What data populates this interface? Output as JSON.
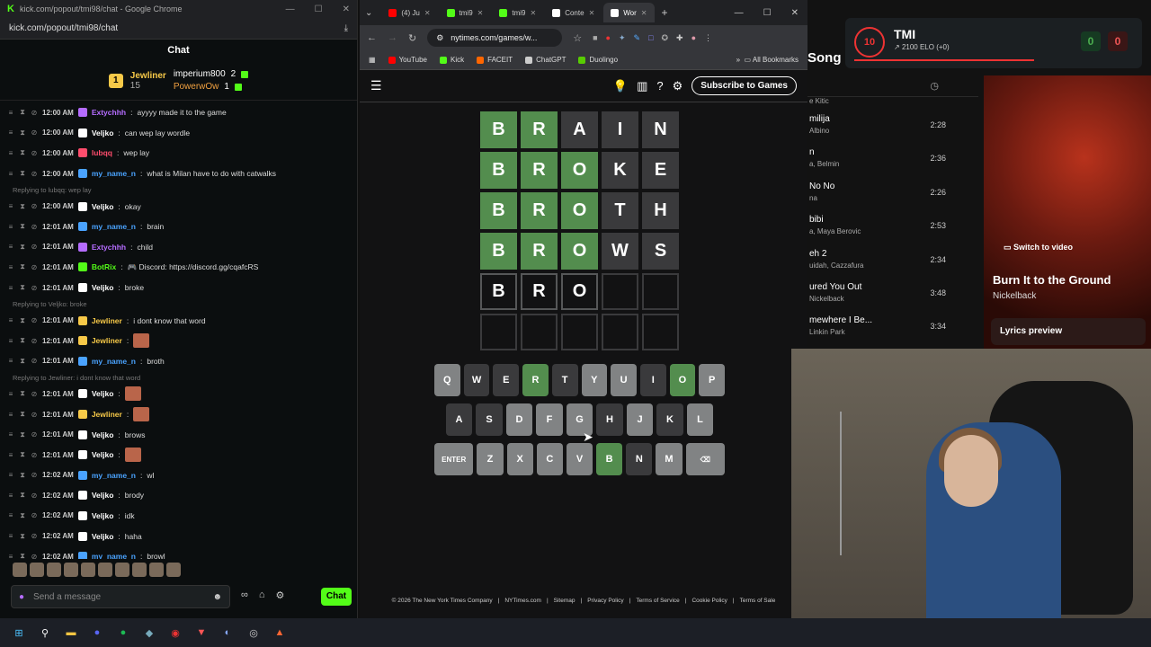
{
  "chat_window": {
    "title": "kick.com/popout/tmi98/chat - Google Chrome",
    "url": "kick.com/popout/tmi98/chat",
    "header": "Chat",
    "leaderboard": {
      "top_name": "Jewliner",
      "top_value": "15",
      "others": [
        {
          "name": "imperium800",
          "value": "2"
        },
        {
          "name": "PowerwOw",
          "value": "1"
        }
      ]
    },
    "messages": [
      {
        "type": "msg",
        "time": "12:00 AM",
        "user": "Extychhh",
        "color": "#b56cff",
        "text": "ayyyy made it to the game"
      },
      {
        "type": "msg",
        "time": "12:00 AM",
        "user": "Veljko",
        "color": "#ffffff",
        "text": "can wep lay wordle"
      },
      {
        "type": "msg",
        "time": "12:00 AM",
        "user": "lubqq",
        "color": "#ff4d6d",
        "text": "wep lay"
      },
      {
        "type": "msg",
        "time": "12:00 AM",
        "user": "my_name_n",
        "color": "#4aa3ff",
        "text": "what is Milan have to do with catwalks"
      },
      {
        "type": "reply",
        "text": "Replying to lubqq: wep lay"
      },
      {
        "type": "msg",
        "time": "12:00 AM",
        "user": "Veljko",
        "color": "#ffffff",
        "text": "okay"
      },
      {
        "type": "msg",
        "time": "12:01 AM",
        "user": "my_name_n",
        "color": "#4aa3ff",
        "text": "brain"
      },
      {
        "type": "msg",
        "time": "12:01 AM",
        "user": "Extychhh",
        "color": "#b56cff",
        "text": "child"
      },
      {
        "type": "msg",
        "time": "12:01 AM",
        "user": "BotRix",
        "color": "#53fc18",
        "text": "🎮 Discord: https://discord.gg/cqafcRS"
      },
      {
        "type": "msg",
        "time": "12:01 AM",
        "user": "Veljko",
        "color": "#ffffff",
        "text": "broke"
      },
      {
        "type": "reply",
        "text": "Replying to Veljko: broke"
      },
      {
        "type": "msg",
        "time": "12:01 AM",
        "user": "Jewliner",
        "color": "#f7c948",
        "text": "i dont know that word"
      },
      {
        "type": "msg",
        "time": "12:01 AM",
        "user": "Jewliner",
        "color": "#f7c948",
        "text": "",
        "emote": true
      },
      {
        "type": "msg",
        "time": "12:01 AM",
        "user": "my_name_n",
        "color": "#4aa3ff",
        "text": "broth"
      },
      {
        "type": "reply",
        "text": "Replying to Jewliner: i dont know that word"
      },
      {
        "type": "msg",
        "time": "12:01 AM",
        "user": "Veljko",
        "color": "#ffffff",
        "text": "",
        "emote": true
      },
      {
        "type": "msg",
        "time": "12:01 AM",
        "user": "Jewliner",
        "color": "#f7c948",
        "text": "",
        "emote": true
      },
      {
        "type": "msg",
        "time": "12:01 AM",
        "user": "Veljko",
        "color": "#ffffff",
        "text": "brows"
      },
      {
        "type": "msg",
        "time": "12:01 AM",
        "user": "Veljko",
        "color": "#ffffff",
        "text": "",
        "emote": true
      },
      {
        "type": "msg",
        "time": "12:02 AM",
        "user": "my_name_n",
        "color": "#4aa3ff",
        "text": "wl"
      },
      {
        "type": "msg",
        "time": "12:02 AM",
        "user": "Veljko",
        "color": "#ffffff",
        "text": "brody"
      },
      {
        "type": "msg",
        "time": "12:02 AM",
        "user": "Veljko",
        "color": "#ffffff",
        "text": "idk"
      },
      {
        "type": "msg",
        "time": "12:02 AM",
        "user": "Veljko",
        "color": "#ffffff",
        "text": "haha"
      },
      {
        "type": "msg",
        "time": "12:02 AM",
        "user": "my_name_n",
        "color": "#4aa3ff",
        "text": "browl"
      }
    ],
    "send_placeholder": "Send a message",
    "chat_button": "Chat"
  },
  "browser": {
    "tabs": [
      {
        "label": "(4) Ju",
        "color": "#ff0000"
      },
      {
        "label": "tmi9",
        "color": "#53fc18"
      },
      {
        "label": "tmi9",
        "color": "#53fc18"
      },
      {
        "label": "Conte",
        "color": "#ffffff"
      },
      {
        "label": "Wor",
        "color": "#ffffff",
        "active": true
      }
    ],
    "url": "nytimes.com/games/w...",
    "bookmarks": [
      "YouTube",
      "Kick",
      "FACEIT",
      "ChatGPT",
      "Duolingo"
    ],
    "all_bookmarks": "All Bookmarks",
    "subscribe": "Subscribe to Games"
  },
  "wordle": {
    "rows": [
      [
        {
          "l": "B",
          "s": "correct"
        },
        {
          "l": "R",
          "s": "correct"
        },
        {
          "l": "A",
          "s": "absent"
        },
        {
          "l": "I",
          "s": "absent"
        },
        {
          "l": "N",
          "s": "absent"
        }
      ],
      [
        {
          "l": "B",
          "s": "correct"
        },
        {
          "l": "R",
          "s": "correct"
        },
        {
          "l": "O",
          "s": "correct"
        },
        {
          "l": "K",
          "s": "absent"
        },
        {
          "l": "E",
          "s": "absent"
        }
      ],
      [
        {
          "l": "B",
          "s": "correct"
        },
        {
          "l": "R",
          "s": "correct"
        },
        {
          "l": "O",
          "s": "correct"
        },
        {
          "l": "T",
          "s": "absent"
        },
        {
          "l": "H",
          "s": "absent"
        }
      ],
      [
        {
          "l": "B",
          "s": "correct"
        },
        {
          "l": "R",
          "s": "correct"
        },
        {
          "l": "O",
          "s": "correct"
        },
        {
          "l": "W",
          "s": "absent"
        },
        {
          "l": "S",
          "s": "absent"
        }
      ],
      [
        {
          "l": "B",
          "s": "tbd"
        },
        {
          "l": "R",
          "s": "tbd"
        },
        {
          "l": "O",
          "s": "tbd"
        },
        {
          "l": "",
          "s": "empty"
        },
        {
          "l": "",
          "s": "empty"
        }
      ],
      [
        {
          "l": "",
          "s": "empty"
        },
        {
          "l": "",
          "s": "empty"
        },
        {
          "l": "",
          "s": "empty"
        },
        {
          "l": "",
          "s": "empty"
        },
        {
          "l": "",
          "s": "empty"
        }
      ]
    ],
    "keyboard": [
      [
        {
          "k": "Q",
          "s": ""
        },
        {
          "k": "W",
          "s": "absent"
        },
        {
          "k": "E",
          "s": "absent"
        },
        {
          "k": "R",
          "s": "correct"
        },
        {
          "k": "T",
          "s": "absent"
        },
        {
          "k": "Y",
          "s": ""
        },
        {
          "k": "U",
          "s": ""
        },
        {
          "k": "I",
          "s": "absent"
        },
        {
          "k": "O",
          "s": "correct"
        },
        {
          "k": "P",
          "s": ""
        }
      ],
      [
        {
          "k": "A",
          "s": "absent"
        },
        {
          "k": "S",
          "s": "absent"
        },
        {
          "k": "D",
          "s": ""
        },
        {
          "k": "F",
          "s": ""
        },
        {
          "k": "G",
          "s": ""
        },
        {
          "k": "H",
          "s": "absent"
        },
        {
          "k": "J",
          "s": ""
        },
        {
          "k": "K",
          "s": "absent"
        },
        {
          "k": "L",
          "s": ""
        }
      ],
      [
        {
          "k": "ENTER",
          "s": "",
          "wide": true
        },
        {
          "k": "Z",
          "s": ""
        },
        {
          "k": "X",
          "s": ""
        },
        {
          "k": "C",
          "s": ""
        },
        {
          "k": "V",
          "s": ""
        },
        {
          "k": "B",
          "s": "correct"
        },
        {
          "k": "N",
          "s": "absent"
        },
        {
          "k": "M",
          "s": ""
        },
        {
          "k": "⌫",
          "s": "",
          "wide": true
        }
      ]
    ],
    "footer": [
      "© 2026 The New York Times Company",
      "NYTimes.com",
      "Sitemap",
      "Privacy Policy",
      "Terms of Service",
      "Cookie Policy",
      "Terms of Sale"
    ]
  },
  "faceit": {
    "level": "10",
    "name": "TMI",
    "elo": "2100 ELO (+0)",
    "wins": "0",
    "losses": "0"
  },
  "spotify": {
    "header": "Song",
    "songs": [
      {
        "title": "",
        "artist": "e Kitic",
        "duration": ""
      },
      {
        "title": "milija",
        "artist": "Albino",
        "duration": "2:28"
      },
      {
        "title": "n",
        "artist": "a, Belmin",
        "duration": "2:36"
      },
      {
        "title": "No No",
        "artist": "na",
        "duration": "2:26"
      },
      {
        "title": "bibi",
        "artist": "a, Maya Berovic",
        "duration": "2:53"
      },
      {
        "title": "eh 2",
        "artist": "uidah, Cazzafura",
        "duration": "2:34"
      },
      {
        "title": "ured You Out",
        "artist": "Nickelback",
        "duration": "3:48"
      },
      {
        "title": "mewhere I Be...",
        "artist": "Linkin Park",
        "duration": "3:34"
      }
    ],
    "switch_video": "Switch to video",
    "now_title": "Burn It to the Ground",
    "now_artist": "Nickelback",
    "lyrics": "Lyrics preview"
  }
}
